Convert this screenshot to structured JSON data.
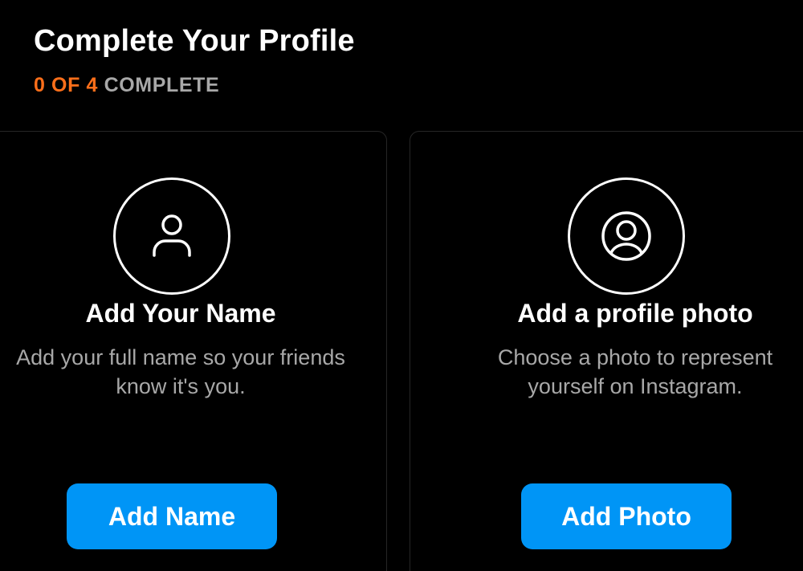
{
  "header": {
    "title": "Complete Your Profile",
    "progress_count": "0 OF 4",
    "progress_suffix": "COMPLETE"
  },
  "cards": [
    {
      "icon": "person-icon",
      "title": "Add Your Name",
      "description": "Add your full name so your friends know it's you.",
      "button_label": "Add Name"
    },
    {
      "icon": "profile-photo-icon",
      "title": "Add a profile photo",
      "description": "Choose a photo to represent yourself on Instagram.",
      "button_label": "Add Photo"
    }
  ],
  "colors": {
    "background": "#000000",
    "accent_orange": "#ff6f1a",
    "button_blue": "#0095f6",
    "muted_text": "#a8a8a8"
  }
}
